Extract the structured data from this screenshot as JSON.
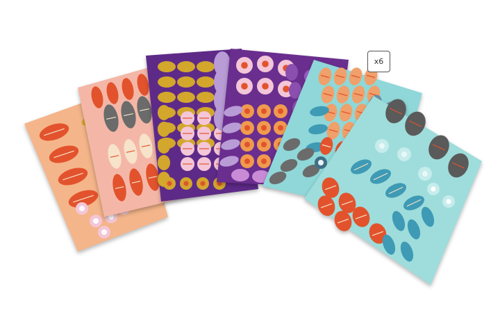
{
  "product": {
    "quantity_badge": "x6",
    "sheets": [
      {
        "name": "peach-sheet",
        "background": "#F5B58A"
      },
      {
        "name": "pink-sheet",
        "background": "#F4B7A7"
      },
      {
        "name": "purple-sheet",
        "background": "#5E2A88"
      },
      {
        "name": "violet-sheet",
        "background": "#6A2E8F"
      },
      {
        "name": "aqua-sheet",
        "background": "#8FD7D8"
      },
      {
        "name": "mint-sheet",
        "background": "#9EDDDB"
      }
    ],
    "sticker_colors": {
      "orange": "#E2532D",
      "ochre": "#D2A72C",
      "grey": "#6B6B6B",
      "blush": "#F3C6D8",
      "teal": "#3E9AB5",
      "cream": "#F6E3C9"
    }
  }
}
